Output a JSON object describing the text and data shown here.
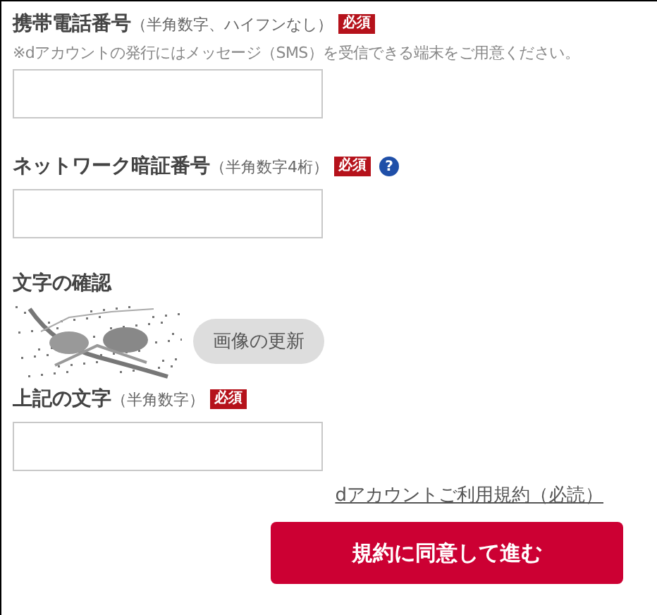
{
  "fields": [
    {
      "kind": "input",
      "label": "携帯電話番号",
      "hint": "（半角数字、ハイフンなし）",
      "required_badge": "必須",
      "note": "※dアカウントの発行にはメッセージ（SMS）を受信できる端末をご用意ください。"
    },
    {
      "kind": "input",
      "label": "ネットワーク暗証番号",
      "hint": "（半角数字4桁）",
      "required_badge": "必須",
      "help": "?"
    },
    {
      "kind": "captcha",
      "label": "文字の確認",
      "refresh_button": "画像の更新"
    },
    {
      "kind": "input",
      "label": "上記の文字",
      "hint": "（半角数字）",
      "required_badge": "必須"
    }
  ],
  "terms_link": "dアカウントご利用規約（必読）",
  "submit_button": "規約に同意して進む"
}
